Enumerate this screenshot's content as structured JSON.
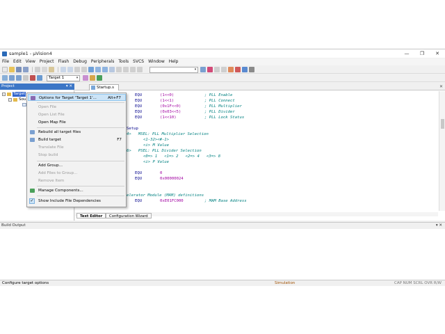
{
  "window": {
    "title": "sample1 - µVision4"
  },
  "window_controls": {
    "minimize": "—",
    "maximize": "❐",
    "close": "✕"
  },
  "menubar": [
    "File",
    "Edit",
    "View",
    "Project",
    "Flash",
    "Debug",
    "Peripherals",
    "Tools",
    "SVCS",
    "Window",
    "Help"
  ],
  "toolbar": {
    "target_combo": "Target 1"
  },
  "project_panel": {
    "title": "Project",
    "pin": "▾ ✕",
    "tree": {
      "target": "Target",
      "source_group": "Sou"
    }
  },
  "editor": {
    "tab": "Startup.s",
    "close": "✕",
    "lines": [
      {
        "a": "EQU",
        "b": "(1<<0)",
        "c": "; PLL Enable"
      },
      {
        "a": "EQU",
        "b": "(1<<1)",
        "c": "; PLL Connect"
      },
      {
        "a": "EQU",
        "b": "(0x1F<<0)",
        "c": "; PLL Multiplier"
      },
      {
        "a": "EQU",
        "b": "(0x03<<5)",
        "c": "; PLL Divider"
      },
      {
        "a": "EQU",
        "b": "(1<<10)",
        "c": "; PLL Lock Status"
      }
    ],
    "setup_label": "Setup",
    "msel": "4>   MSEL: PLL Multiplier Selection",
    "msel_range": "<1-32><#-1>",
    "m_value": "<i> M Value",
    "psel": "6>   PSEL: PLL Divider Selection",
    "psel_opts": "<0=> 1   <1=> 2   <2=> 4   <3=> 8",
    "p_value": "<i> P Value",
    "eq1": {
      "a": "EQU",
      "b": "0"
    },
    "eq2": {
      "a": "EQU",
      "b": "0x00000024"
    },
    "mam_comment": "elerator Module (MAM) definitions",
    "mam_line": {
      "a": "EQU",
      "b": "0xE01FC000",
      "c": "; MAM Base Address"
    }
  },
  "bottom_tabs": [
    "Text Editor",
    "Configuration Wizard"
  ],
  "build_output": {
    "title": "Build Output",
    "pin": "▾ ✕"
  },
  "statusbar": {
    "left": "Configure target options",
    "simulation": "Simulation",
    "indicators": "CAP NUM SCRL OVR R/W"
  },
  "context_menu": {
    "items": [
      {
        "label": "Options for Target 'Target 1'...",
        "accel": "Alt+F7",
        "disabled": false,
        "highlight": true,
        "icon": "options-icon"
      },
      {
        "label": "Open File",
        "accel": "",
        "disabled": true
      },
      {
        "label": "Open List File",
        "accel": "",
        "disabled": true
      },
      {
        "label": "Open Map File",
        "accel": "",
        "disabled": false
      },
      {
        "label": "Rebuild all target files",
        "accel": "",
        "disabled": false,
        "icon": "rebuild-icon"
      },
      {
        "label": "Build target",
        "accel": "F7",
        "disabled": false,
        "icon": "build-icon"
      },
      {
        "label": "Translate File",
        "accel": "",
        "disabled": true
      },
      {
        "label": "Stop build",
        "accel": "",
        "disabled": true
      },
      {
        "label": "Add Group...",
        "accel": "",
        "disabled": false
      },
      {
        "label": "Add Files to Group...",
        "accel": "",
        "disabled": true
      },
      {
        "label": "Remove Item",
        "accel": "",
        "disabled": true
      },
      {
        "label": "Manage Components...",
        "accel": "",
        "disabled": false,
        "icon": "components-icon"
      },
      {
        "label": "Show Include File Dependencies",
        "accel": "",
        "disabled": false,
        "checked": true
      }
    ]
  },
  "colors": {
    "accent": "#3c76c6",
    "menu_highlight": "#cce4f7",
    "keyword": "#00008b",
    "comment": "#008080"
  }
}
